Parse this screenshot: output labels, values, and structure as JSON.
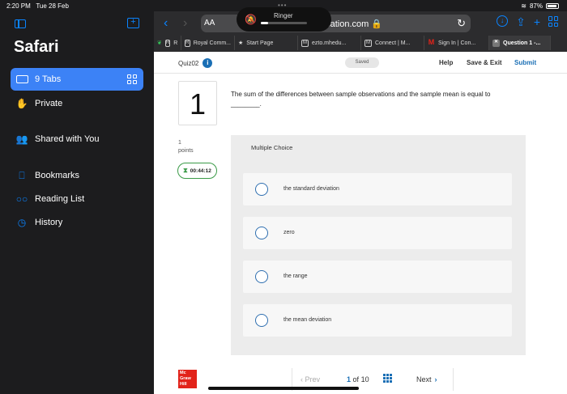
{
  "status": {
    "time": "2:20 PM",
    "date": "Tue 28 Feb",
    "battery": "87%"
  },
  "sidebar": {
    "title": "Safari",
    "items": [
      {
        "label": "9 Tabs",
        "icon": "tabs-icon",
        "active": true
      },
      {
        "label": "Private",
        "icon": "hand-icon"
      },
      {
        "label": "Shared with You",
        "icon": "people-icon"
      },
      {
        "label": "Bookmarks",
        "icon": "bookmark-icon"
      },
      {
        "label": "Reading List",
        "icon": "glasses-icon"
      },
      {
        "label": "History",
        "icon": "clock-icon"
      }
    ]
  },
  "browser": {
    "aa": "AA",
    "url": "ucation.com",
    "ringer": "Ringer",
    "ringer_level": 0.15,
    "tabs": [
      {
        "label": "R",
        "fav": ""
      },
      {
        "label": "Royal Comm...",
        "fav": "R"
      },
      {
        "label": "Start Page",
        "fav": "★"
      },
      {
        "label": "ezto.mhedu...",
        "fav": "M"
      },
      {
        "label": "Connect | M...",
        "fav": "M"
      },
      {
        "label": "Sign In | Con...",
        "fav": "M"
      },
      {
        "label": "Question 1 -...",
        "fav": "✕"
      }
    ]
  },
  "quiz": {
    "name": "Quiz02",
    "saved": "Saved",
    "help": "Help",
    "save_exit": "Save & Exit",
    "submit": "Submit",
    "number": "1",
    "question": "The sum of the differences between sample observations and the sample mean is equal to ________.",
    "points_value": "1",
    "points_label": "points",
    "timer": "00:44:12",
    "type": "Multiple Choice",
    "choices": [
      "the standard deviation",
      "zero",
      "the range",
      "the mean deviation"
    ]
  },
  "footer": {
    "logo": [
      "Mc",
      "Graw",
      "Hill"
    ],
    "prev": "Prev",
    "page": "1",
    "of": "of",
    "total": "10",
    "next": "Next"
  }
}
